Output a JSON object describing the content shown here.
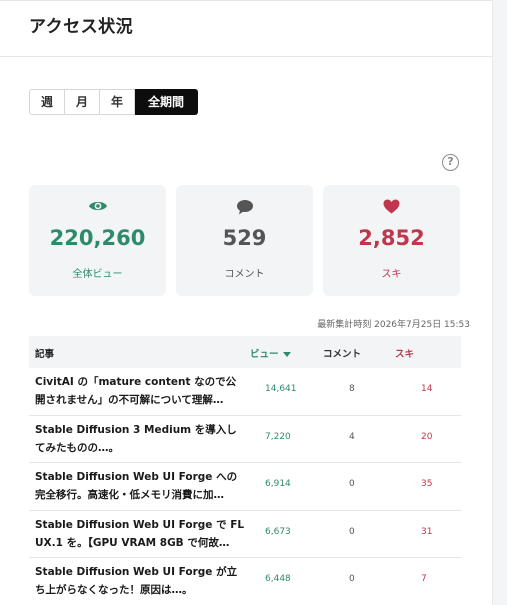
{
  "page": {
    "title": "アクセス状況"
  },
  "period_tabs": [
    {
      "label": "週",
      "active": false
    },
    {
      "label": "月",
      "active": false
    },
    {
      "label": "年",
      "active": false
    },
    {
      "label": "全期間",
      "active": true
    }
  ],
  "stats": {
    "views": {
      "value": "220,260",
      "label": "全体ビュー",
      "icon": "eye-icon",
      "color": "#2e8b6a"
    },
    "comments": {
      "value": "529",
      "label": "コメント",
      "icon": "speech-bubble-icon",
      "color": "#555555"
    },
    "likes": {
      "value": "2,852",
      "label": "スキ",
      "icon": "heart-icon",
      "color": "#c0364c"
    }
  },
  "updated_text": "最新集計時刻 2026年7月25日 15:53",
  "table": {
    "headers": {
      "article": "記事",
      "views": "ビュー",
      "comments": "コメント",
      "likes": "スキ"
    },
    "rows": [
      {
        "title": "CivitAI の「mature content なので公開されません」の不可解について理解…",
        "views": "14,641",
        "comments": "8",
        "likes": "14"
      },
      {
        "title": "Stable Diffusion 3 Medium を導入してみたものの…。",
        "views": "7,220",
        "comments": "4",
        "likes": "20"
      },
      {
        "title": "Stable Diffusion Web UI Forge への完全移行。高速化・低メモリ消費に加…",
        "views": "6,914",
        "comments": "0",
        "likes": "35"
      },
      {
        "title": "Stable Diffusion Web UI Forge で FLUX.1 を。【GPU VRAM 8GB で何故…",
        "views": "6,673",
        "comments": "0",
        "likes": "31"
      },
      {
        "title": "Stable Diffusion Web UI Forge が立ち上がらなくなった！原因は…。",
        "views": "6,448",
        "comments": "0",
        "likes": "7"
      }
    ]
  }
}
